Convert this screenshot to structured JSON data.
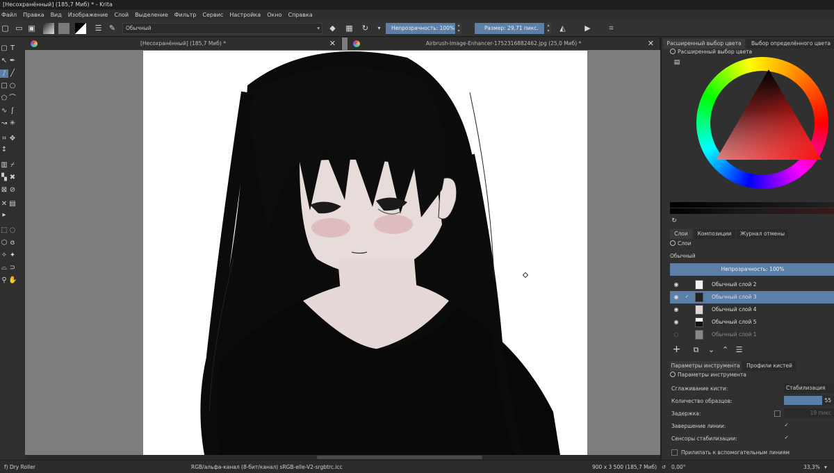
{
  "window": {
    "title": "[Несохранённый]  (185,7 Миб) * - Krita"
  },
  "menu": [
    "Файл",
    "Правка",
    "Вид",
    "Изображение",
    "Слой",
    "Выделение",
    "Фильтр",
    "Сервис",
    "Настройка",
    "Окно",
    "Справка"
  ],
  "toolbar": {
    "preset_name": "Обычный",
    "opacity_label": "Непрозрачность: 100%",
    "size_label": "Размер: 29,71 пикс."
  },
  "documents": [
    {
      "title": "[Несохранённый]  (185,7 Миб) *",
      "close": "✕"
    },
    {
      "title": "Airbrush-Image-Enhancer-1752316882462.jpg (25,0 Миб) *",
      "close": "✕"
    }
  ],
  "color_panel": {
    "tabs": [
      "Расширенный выбор цвета",
      "Выбор определённого цвета"
    ],
    "section_title": "Расширенный выбор цвета"
  },
  "layers_panel": {
    "tabs": [
      "Слои",
      "Композиции",
      "Журнал отмены"
    ],
    "section_title": "Слои",
    "blend_mode": "Обычный",
    "opacity_label": "Непрозрачность:  100%",
    "layers": [
      {
        "name": "Обычный слой 2",
        "visible": true,
        "selected": false,
        "dim": false
      },
      {
        "name": "Обычный слой 3",
        "visible": true,
        "selected": true,
        "dim": false
      },
      {
        "name": "Обычный слой 4",
        "visible": true,
        "selected": false,
        "dim": false
      },
      {
        "name": "Обычный слой 5",
        "visible": true,
        "selected": false,
        "dim": false
      },
      {
        "name": "Обычный слой 1",
        "visible": false,
        "selected": false,
        "dim": true
      }
    ]
  },
  "tool_options": {
    "tabs": [
      "Параметры инструмента",
      "Профили кистей"
    ],
    "section_title": "Параметры инструмента",
    "smoothing_label": "Сглаживание кисти:",
    "smoothing_value": "Стабилизация",
    "samples_label": "Количество образцов:",
    "samples_value": "55",
    "samples_fraction": 0.76,
    "delay_label": "Задержка:",
    "delay_value": "19 пикс",
    "finish_label": "Завершение линии:",
    "finish_checked": true,
    "sensors_label": "Сенсоры стабилизации:",
    "sensors_checked": true,
    "snap_label": "Прилипать к вспомогательным линиям"
  },
  "statusbar": {
    "brush": "f) Dry Roller",
    "colorspace": "RGB/альфа-канал (8-бит/канал)  sRGB-elle-V2-srgbtrc.icc",
    "dimensions": "900 x 3 500 (185,7 Миб)",
    "rotation": "0,00°",
    "zoom": "33,3%"
  }
}
